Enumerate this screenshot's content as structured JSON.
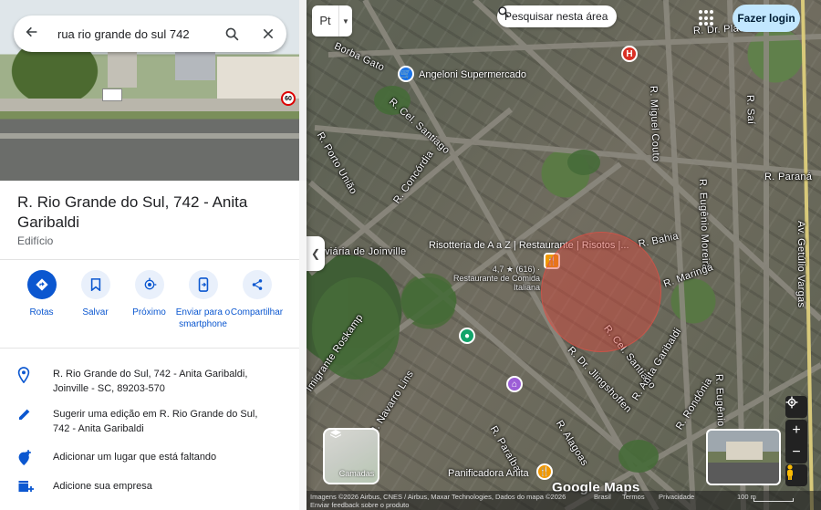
{
  "search": {
    "query": "rua rio grande do sul 742"
  },
  "place": {
    "title": "R. Rio Grande do Sul, 742 - Anita Garibaldi",
    "type": "Edifício",
    "speed_sign": "60"
  },
  "actions": [
    {
      "label": "Rotas",
      "icon": "directions-icon"
    },
    {
      "label": "Salvar",
      "icon": "bookmark-icon"
    },
    {
      "label": "Próximo",
      "icon": "nearby-icon"
    },
    {
      "label": "Enviar para o smartphone",
      "icon": "send-to-phone-icon"
    },
    {
      "label": "Compartilhar",
      "icon": "share-icon"
    }
  ],
  "info": {
    "address": "R. Rio Grande do Sul, 742 - Anita Garibaldi, Joinville - SC, 89203-570",
    "suggest_edit": "Sugerir uma edição em R. Rio Grande do Sul, 742 - Anita Garibaldi",
    "add_place": "Adicionar um lugar que está faltando",
    "add_business": "Adicione sua empresa"
  },
  "map": {
    "map_type": "Pt",
    "search_area": "Pesquisar nesta área",
    "login": "Fazer login",
    "layers": "Camadas",
    "brand": "Google Maps",
    "attribution": "Imagens ©2026 Airbus, CNES / Airbus, Maxar Technologies, Dados do mapa ©2026",
    "feedback": "Enviar feedback sobre o produto",
    "country": "Brasil",
    "terms": "Termos",
    "privacy": "Privacidade",
    "scale": "100 m",
    "streets": [
      "Borba Gato",
      "R. Dr. Plácido Gomes",
      "R. Cel. Santiago",
      "R. Porto União",
      "R. Concórdia",
      "R. Miguel Couto",
      "R. Saí",
      "R. Eugênio Moreira",
      "R. Paraná",
      "Av. Getúlio Vargas",
      "R. Bahia",
      "R. Maringá",
      "R. Cel. Santiago",
      "R. Anita Garibaldi",
      "R. Dr. Jlingshoffen",
      "Imigrante Roskamp",
      "R. Navarro Lins",
      "R. Alagoas",
      "R. Paraíba",
      "R. Rondônia",
      "R. Eugênio Moreira",
      "viária de Joinville",
      "Bl"
    ],
    "pois": {
      "supermarket": "Angeloni Supermercado",
      "restaurant_name": "Risotteria de A a Z | Restaurante | Risotos |...",
      "restaurant_rating": "4,7 ★ (616) · Restaurante de Comida Italiana",
      "bakery": "Panificadora Anita",
      "hospital_badge": "H"
    }
  }
}
